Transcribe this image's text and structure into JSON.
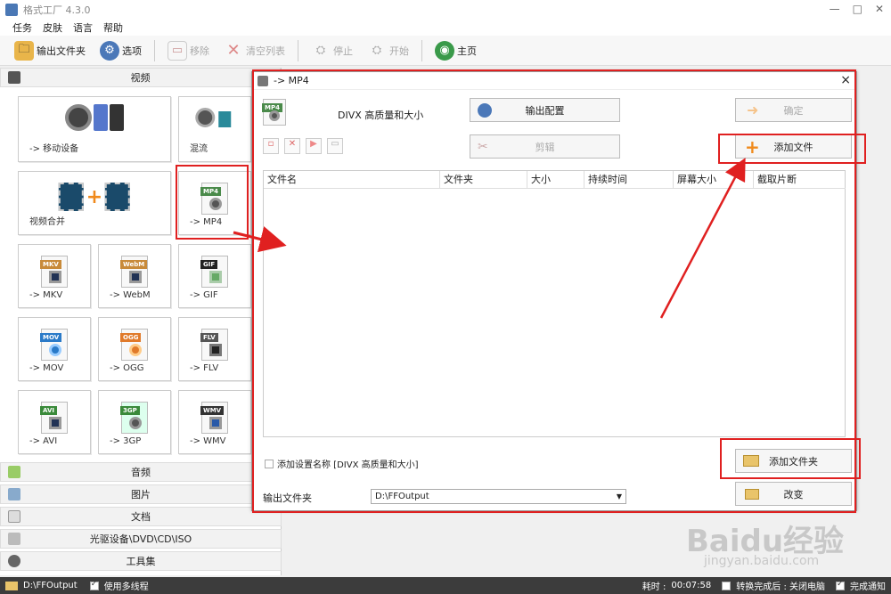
{
  "window": {
    "title": "格式工厂 4.3.0",
    "controls": [
      "—",
      "□",
      "✕"
    ]
  },
  "menu": [
    "任务",
    "皮肤",
    "语言",
    "帮助"
  ],
  "toolbar": {
    "output_folder": "输出文件夹",
    "options": "选项",
    "remove": "移除",
    "clear_list": "清空列表",
    "stop": "停止",
    "start": "开始",
    "home": "主页"
  },
  "left": {
    "video_header": "视频",
    "tiles": [
      "-> 移动设备",
      "混流",
      "视频合并",
      "-> MP4",
      "-> MKV",
      "-> WebM",
      "-> GIF",
      "-> MOV",
      "-> OGG",
      "-> FLV",
      "-> AVI",
      "-> 3GP",
      "-> WMV"
    ],
    "tags": {
      "mp4": "MP4",
      "mkv": "MKV",
      "webm": "WebM",
      "gif": "GIF",
      "mov": "MOV",
      "ogg": "OGG",
      "flv": "FLV",
      "avi": "AVI",
      "gp": "3GP",
      "wmv": "WMV"
    },
    "categories": [
      "音频",
      "图片",
      "文档",
      "光驱设备\\DVD\\CD\\ISO",
      "工具集"
    ]
  },
  "dialog": {
    "title": "-> MP4",
    "close": "×",
    "icon_tag": "MP4",
    "preset": "DIVX 高质量和大小",
    "output_config": "输出配置",
    "ok": "确定",
    "clip": "剪辑",
    "add_file": "添加文件",
    "columns": [
      "文件名",
      "文件夹",
      "大小",
      "持续时间",
      "屏幕大小",
      "截取片断"
    ],
    "add_setting_name": "添加设置名称 [DIVX 高质量和大小]",
    "add_folder": "添加文件夹",
    "output_folder_label": "输出文件夹",
    "output_folder_value": "D:\\FFOutput",
    "change": "改变"
  },
  "status": {
    "path": "D:\\FFOutput",
    "multithread": "使用多线程",
    "elapsed_label": "耗时 :",
    "elapsed": "00:07:58",
    "shutdown": "转换完成后 : 关闭电脑",
    "notify": "完成通知"
  },
  "watermark": {
    "logo": "Baidu经验",
    "url": "jingyan.baidu.com"
  },
  "colors": {
    "highlight": "#e02020",
    "accent_orange": "#f08a1c",
    "status_bg": "#3c3c3c"
  }
}
